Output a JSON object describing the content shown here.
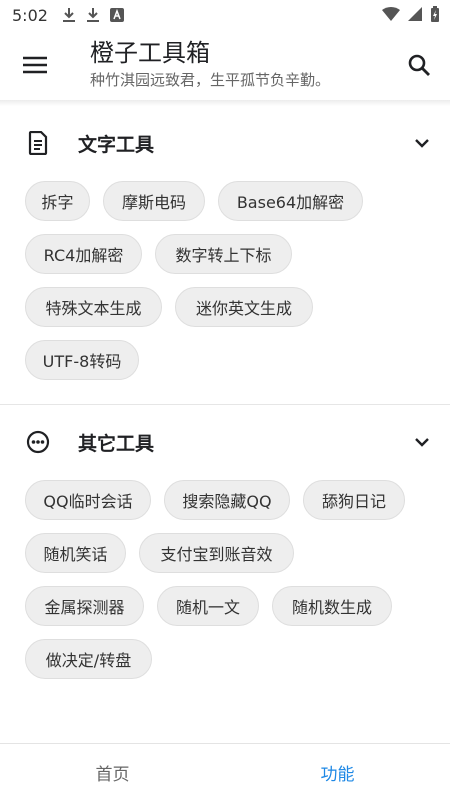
{
  "status_bar": {
    "time": "5:02",
    "left_icons": [
      "download-icon",
      "download-icon",
      "app-notification-icon"
    ],
    "right_icons": [
      "wifi-icon",
      "cellular-signal-icon",
      "battery-charging-icon"
    ]
  },
  "app_bar": {
    "title": "橙子工具箱",
    "subtitle": "种竹淇园远致君，生平孤节负辛勤。",
    "menu_icon": "menu-icon",
    "search_icon": "search-icon"
  },
  "sections": [
    {
      "title": "文字工具",
      "icon": "document-icon",
      "expanded": true,
      "tools": [
        "拆字",
        "摩斯电码",
        "Base64加解密",
        "RC4加解密",
        "数字转上下标",
        "特殊文本生成",
        "迷你英文生成",
        "UTF-8转码"
      ]
    },
    {
      "title": "其它工具",
      "icon": "more-circle-icon",
      "expanded": true,
      "tools": [
        "QQ临时会话",
        "搜索隐藏QQ",
        "舔狗日记",
        "随机笑话",
        "支付宝到账音效",
        "金属探测器",
        "随机一文",
        "随机数生成",
        "做决定/转盘"
      ]
    }
  ],
  "bottom_nav": {
    "items": [
      {
        "label": "首页",
        "active": false
      },
      {
        "label": "功能",
        "active": true
      }
    ]
  },
  "colors": {
    "accent": "#1e88e5",
    "chip_background": "#eeeeee",
    "text_primary": "#202124"
  }
}
